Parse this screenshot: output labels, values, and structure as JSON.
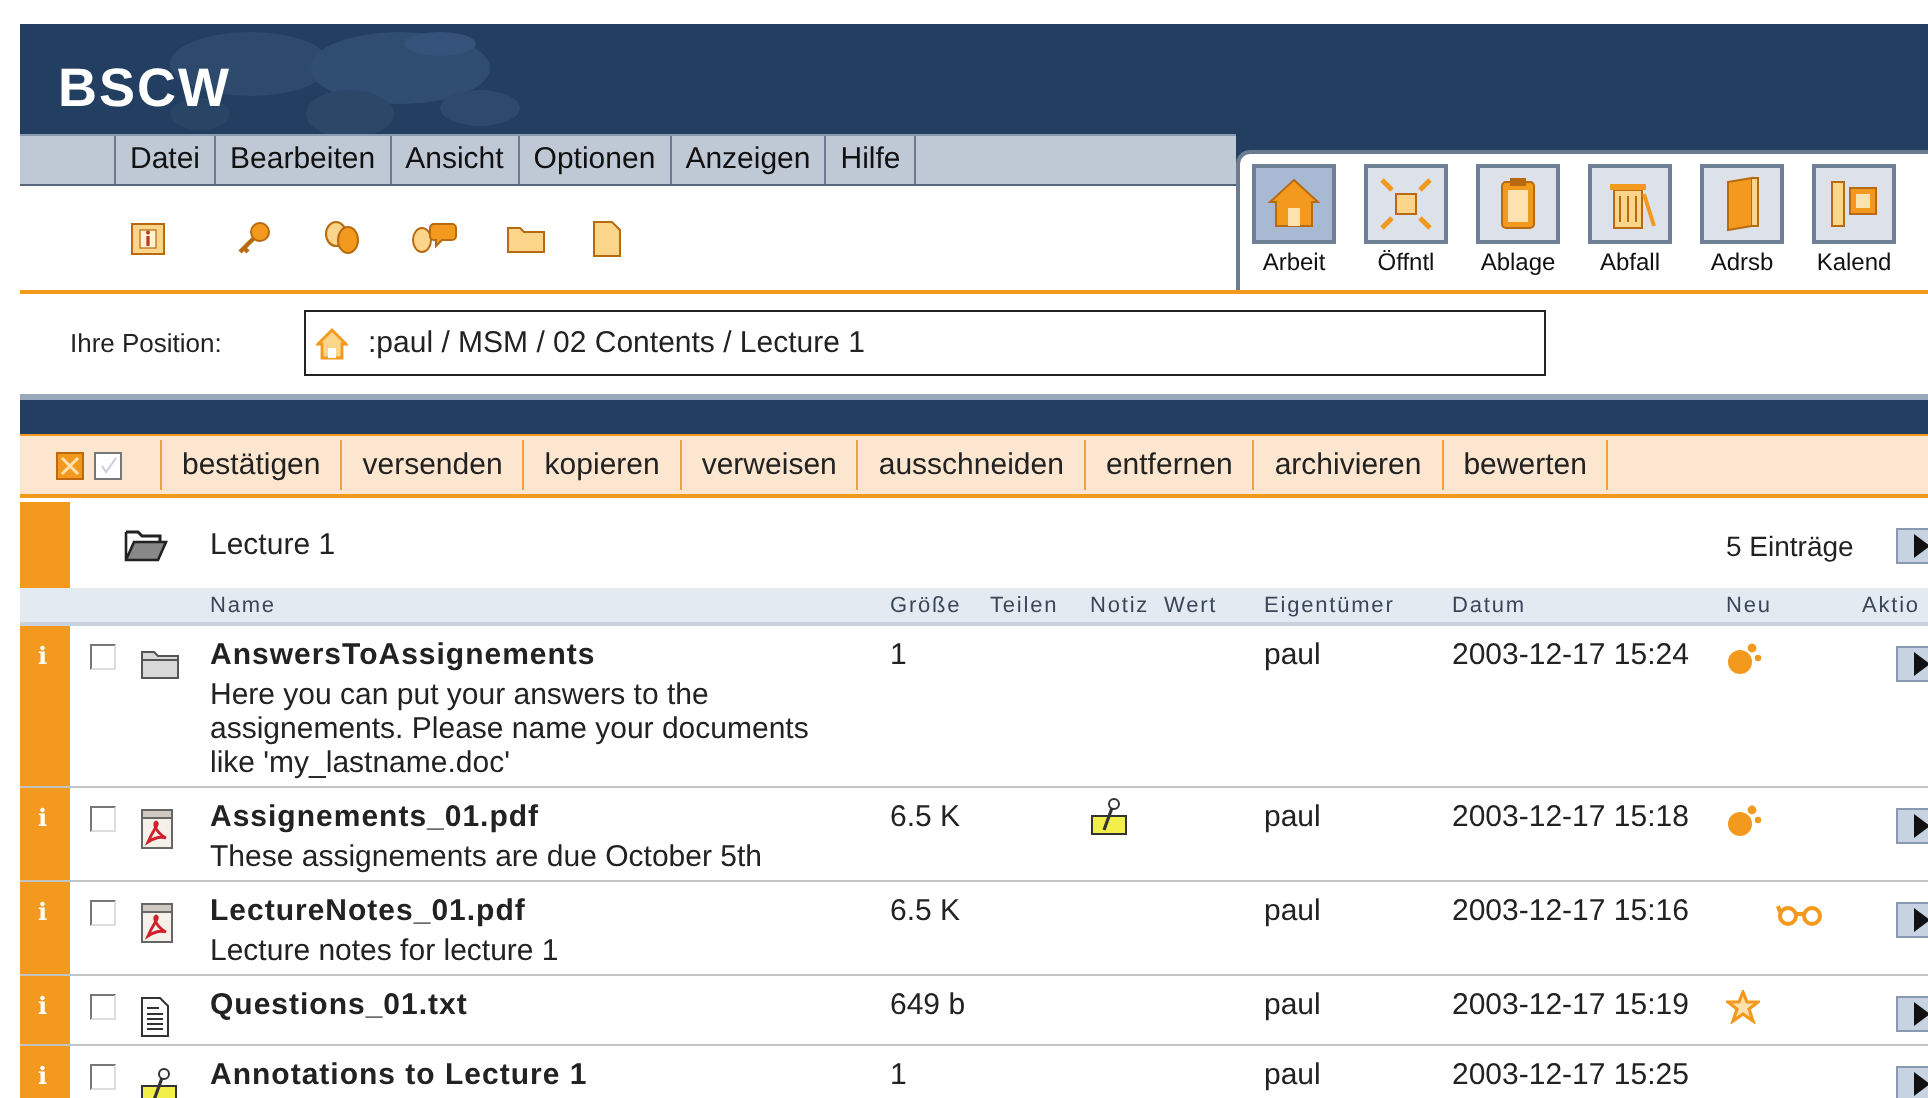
{
  "logo": "BSCW",
  "menu": [
    "Datei",
    "Bearbeiten",
    "Ansicht",
    "Optionen",
    "Anzeigen",
    "Hilfe"
  ],
  "places": [
    {
      "label": "Arbeit",
      "kind": "home",
      "selected": true
    },
    {
      "label": "Öffntl",
      "kind": "public",
      "selected": false
    },
    {
      "label": "Ablage",
      "kind": "clipboard",
      "selected": false
    },
    {
      "label": "Abfall",
      "kind": "trash",
      "selected": false
    },
    {
      "label": "Adrsb",
      "kind": "addressbook",
      "selected": false
    },
    {
      "label": "Kalend",
      "kind": "calendar",
      "selected": false
    }
  ],
  "position": {
    "label": "Ihre Position:",
    "path": ":paul / MSM / 02 Contents / Lecture 1"
  },
  "actions": [
    "bestätigen",
    "versenden",
    "kopieren",
    "verweisen",
    "ausschneiden",
    "entfernen",
    "archivieren",
    "bewerten"
  ],
  "folder": {
    "name": "Lecture 1",
    "count": "5 Einträge"
  },
  "columns": [
    "Name",
    "Größe",
    "Teilen",
    "Notiz",
    "Wert",
    "Eigentümer",
    "Datum",
    "Neu",
    "Aktio"
  ],
  "rows": [
    {
      "marker": "i",
      "checked": false,
      "kind": "folder",
      "name": "AnswersToAssignements",
      "description": "Here you can put your answers to the assignements. Please name your documents like 'my_lastname.doc'",
      "size": "1",
      "note": false,
      "owner": "paul",
      "date": "2003-12-17 15:24",
      "status": {
        "kind": "new"
      }
    },
    {
      "marker": "i",
      "checked": false,
      "kind": "pdf",
      "name": "Assignements_01.pdf",
      "description": "These assignements are due October 5th",
      "size": "6.5 K",
      "note": true,
      "owner": "paul",
      "date": "2003-12-17 15:18",
      "status": {
        "kind": "new"
      }
    },
    {
      "marker": "i",
      "checked": false,
      "kind": "pdf",
      "name": "LectureNotes_01.pdf",
      "description": "Lecture notes for lecture 1",
      "size": "6.5 K",
      "note": false,
      "owner": "paul",
      "date": "2003-12-17 15:16",
      "status": {
        "kind": "read"
      }
    },
    {
      "marker": "i",
      "checked": false,
      "kind": "text",
      "name": "Questions_01.txt",
      "size": "649 b",
      "note": false,
      "owner": "paul",
      "date": "2003-12-17 15:19",
      "status": {
        "kind": "changed"
      }
    },
    {
      "marker": "i",
      "checked": false,
      "kind": "note",
      "name": "Annotations to Lecture 1",
      "size": "1",
      "note": false,
      "owner": "paul",
      "date": "2003-12-17 15:25"
    }
  ]
}
